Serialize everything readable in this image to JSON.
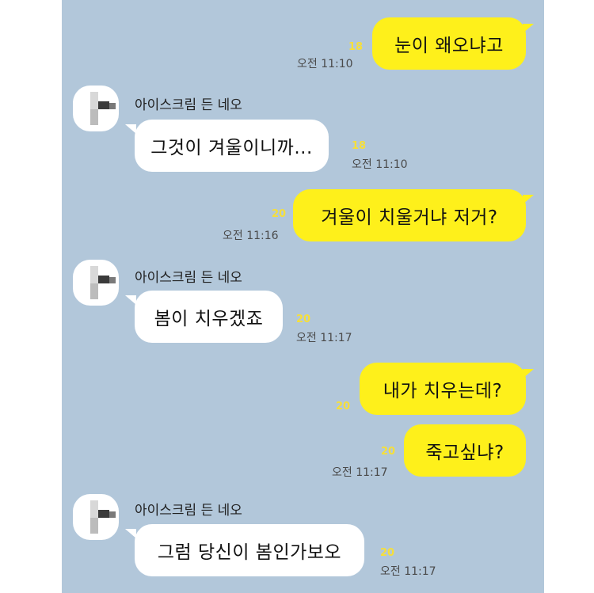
{
  "chat": {
    "background_color": "#b2c7da",
    "my_bubble_color": "#fef01b",
    "their_bubble_color": "#ffffff",
    "unread_color": "#f6df3a",
    "messages": [
      {
        "sender": "me",
        "text": "눈이 왜오냐고",
        "unread": "18",
        "time": "오전 11:10"
      },
      {
        "sender": "other",
        "name": "아이스크림 든 네오",
        "text": "그것이 겨울이니까...",
        "unread": "18",
        "time": "오전 11:10"
      },
      {
        "sender": "me",
        "text": "겨울이 치울거냐 저거?",
        "unread": "20",
        "time": "오전 11:16"
      },
      {
        "sender": "other",
        "name": "아이스크림 든 네오",
        "text": "봄이 치우겠죠",
        "unread": "20",
        "time": "오전 11:17"
      },
      {
        "sender": "me",
        "text": "내가 치우는데?",
        "unread": "20",
        "time": ""
      },
      {
        "sender": "me",
        "text": "죽고싶냐?",
        "unread": "20",
        "time": "오전 11:17"
      },
      {
        "sender": "other",
        "name": "아이스크림 든 네오",
        "text": "그럼 당신이 봄인가보오",
        "unread": "20",
        "time": "오전 11:17"
      }
    ]
  }
}
